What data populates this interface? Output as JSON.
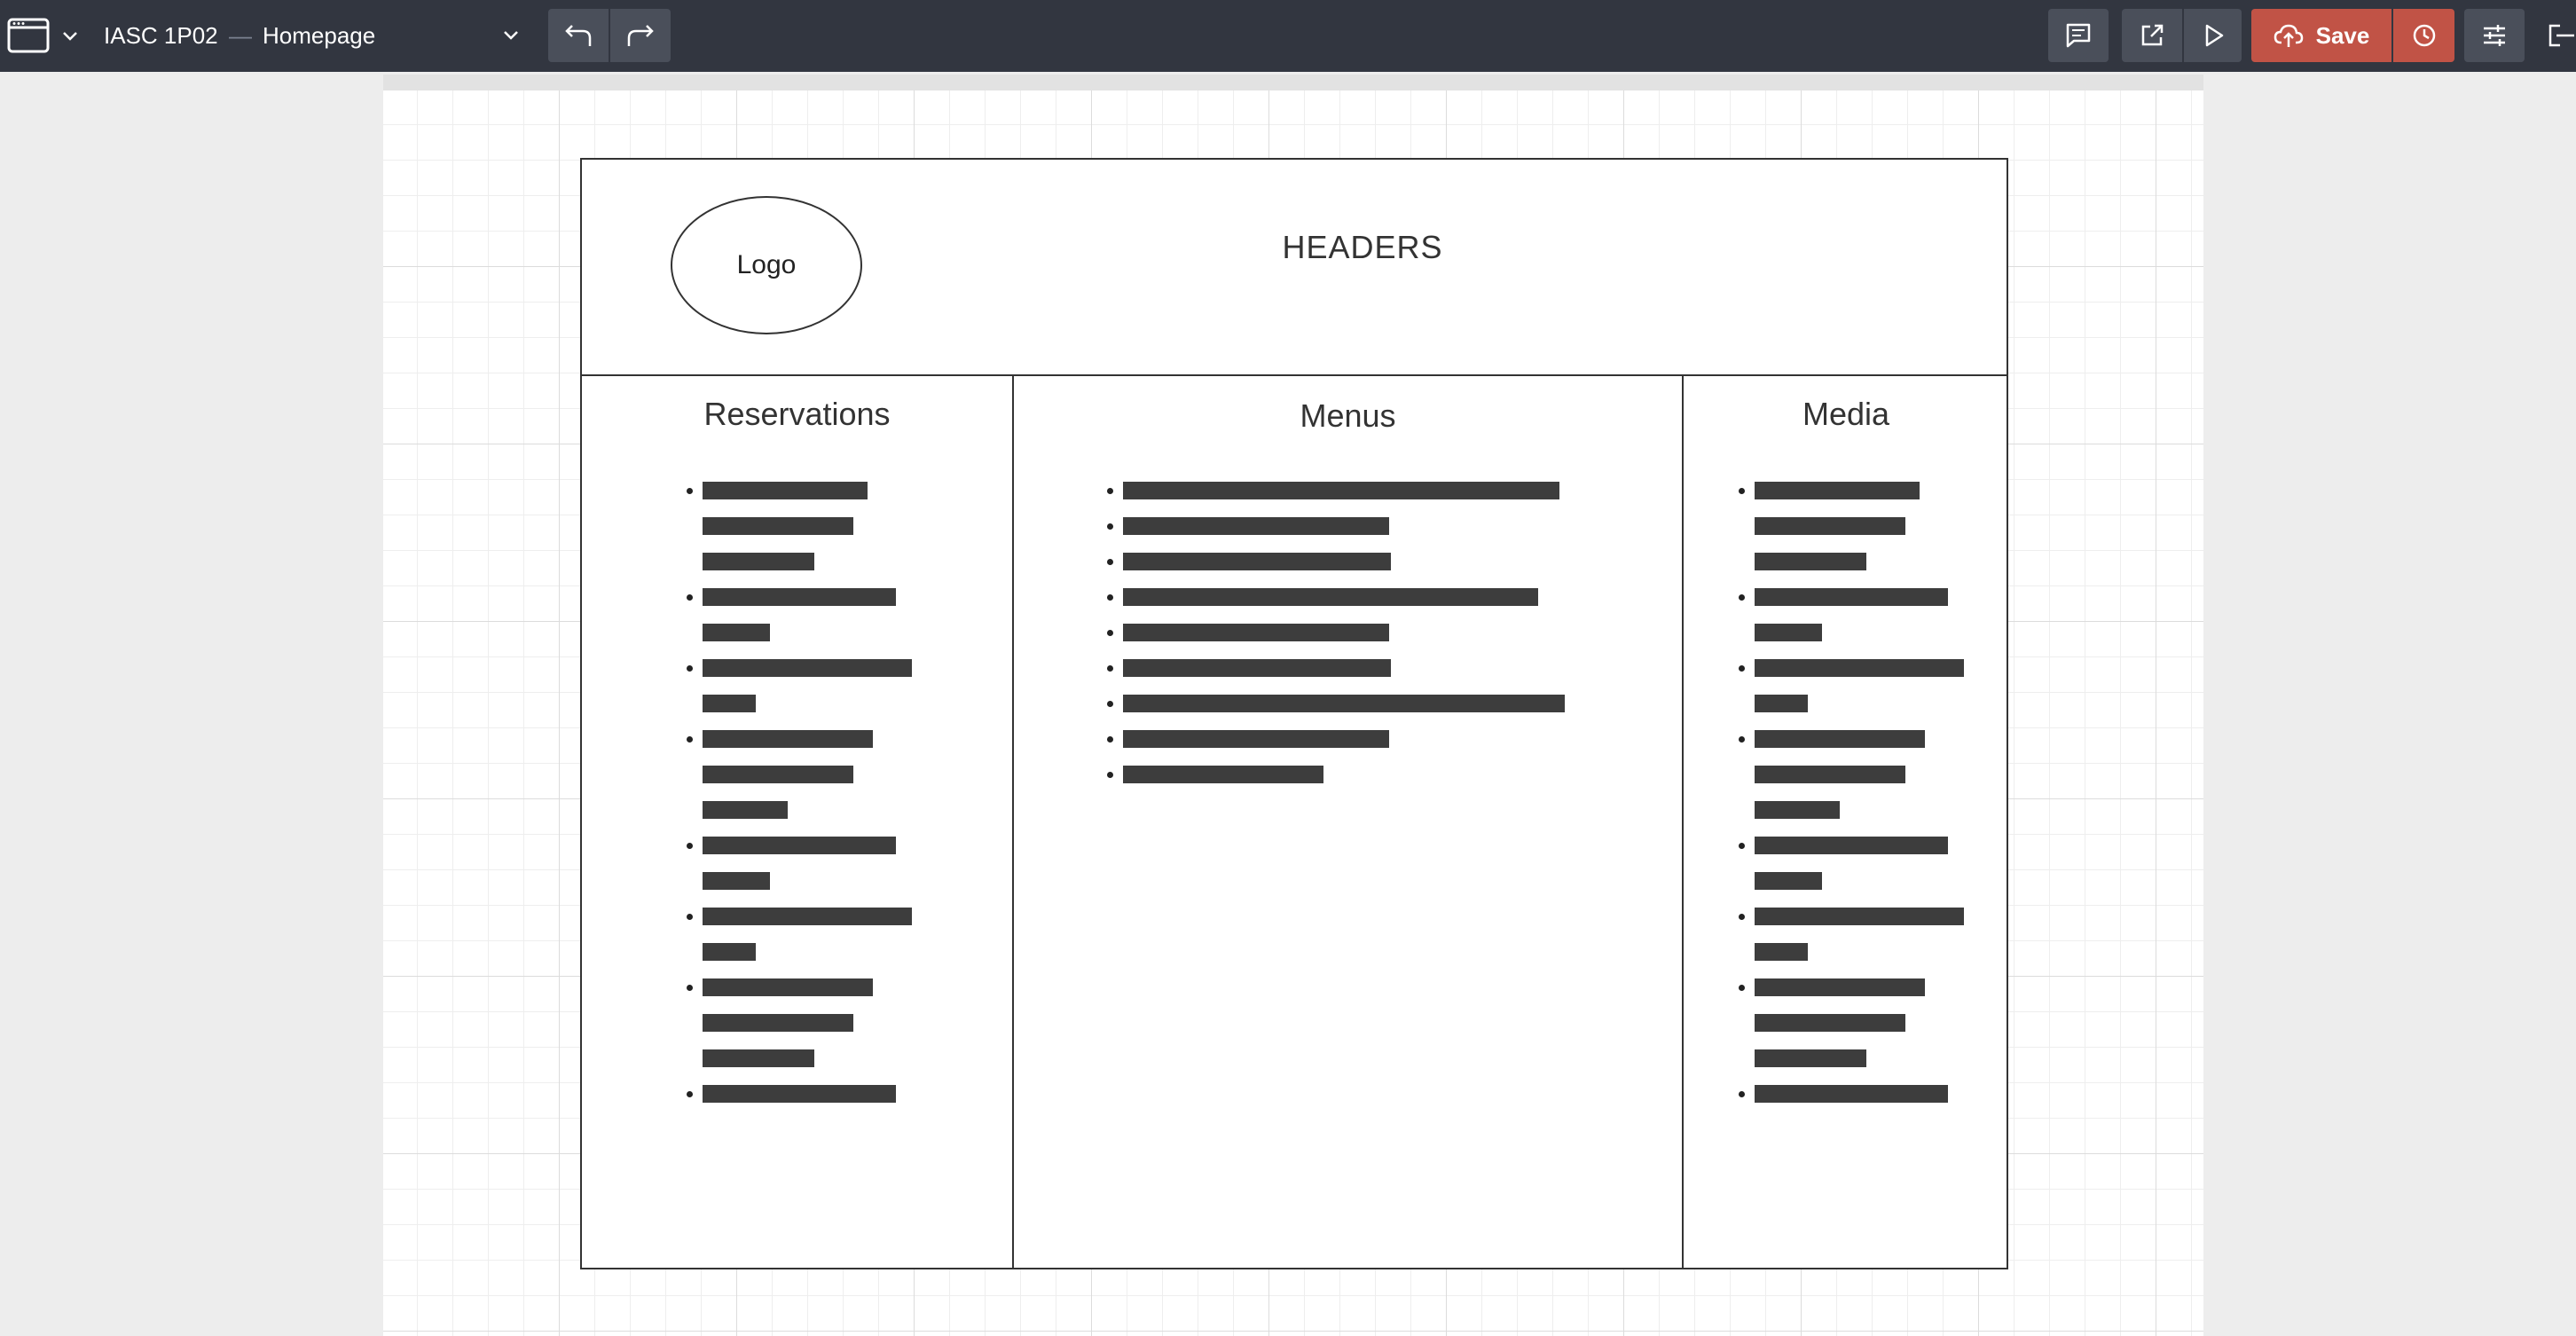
{
  "toolbar": {
    "app_icon": "window-icon",
    "document_name": "IASC 1P02",
    "separator": "—",
    "page_name": "Homepage",
    "save_label": "Save",
    "icons": {
      "undo": "undo-icon",
      "redo": "redo-icon",
      "comments": "comment-icon",
      "open_external": "external-link-icon",
      "preview": "play-icon",
      "save": "cloud-upload-icon",
      "history": "clock-icon",
      "settings": "sliders-icon",
      "exit": "exit-icon"
    },
    "colors": {
      "bar_bg": "#323640",
      "button_bg": "#4a4f5a",
      "save_bg": "#c15346"
    }
  },
  "wireframe": {
    "logo_label": "Logo",
    "header_label": "HEADERS",
    "columns": [
      {
        "title": "Reservations"
      },
      {
        "title": "Menus"
      },
      {
        "title": "Media"
      }
    ]
  }
}
